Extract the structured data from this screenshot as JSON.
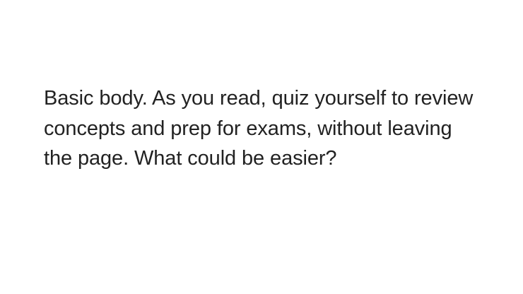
{
  "body": {
    "paragraph": "Basic body. As you read, quiz yourself to review concepts and prep for exams, without leaving the page. What could be easier?"
  },
  "colors": {
    "background": "#ffffff",
    "text": "#222222"
  }
}
